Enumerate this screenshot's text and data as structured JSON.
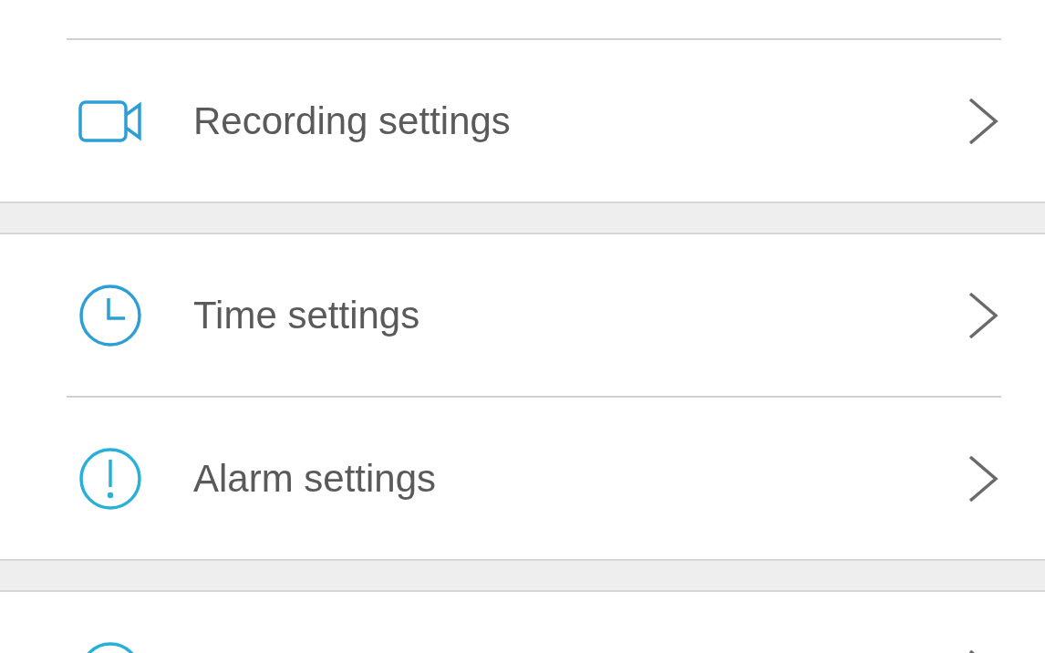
{
  "groups": [
    {
      "items": [
        {
          "kind": "video",
          "label": "Recording settings"
        }
      ]
    },
    {
      "items": [
        {
          "kind": "clock",
          "label": "Time settings"
        },
        {
          "kind": "alert",
          "label": "Alarm settings"
        }
      ]
    },
    {
      "items": [
        {
          "kind": "ring"
        }
      ]
    }
  ]
}
